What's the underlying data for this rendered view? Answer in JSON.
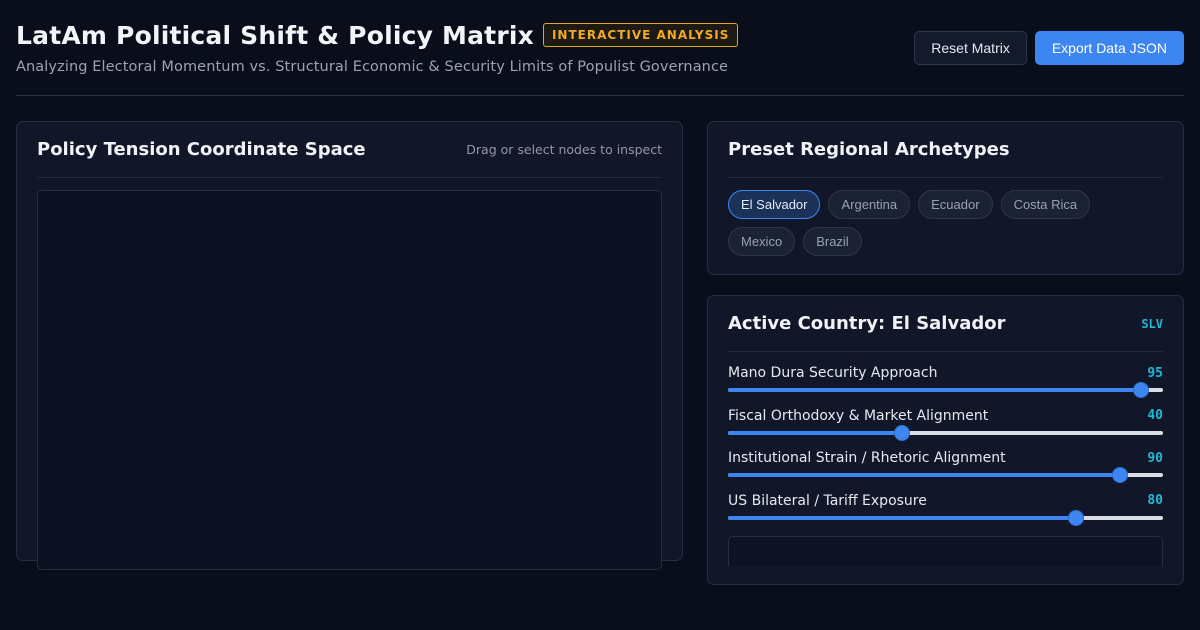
{
  "header": {
    "title": "LatAm Political Shift & Policy Matrix",
    "badge": "INTERACTIVE ANALYSIS",
    "subtitle": "Analyzing Electoral Momentum vs. Structural Economic & Security Limits of Populist Governance",
    "reset_label": "Reset Matrix",
    "export_label": "Export Data JSON"
  },
  "coordinate_panel": {
    "title": "Policy Tension Coordinate Space",
    "hint": "Drag or select nodes to inspect"
  },
  "presets": {
    "title": "Preset Regional Archetypes",
    "items": [
      "El Salvador",
      "Argentina",
      "Ecuador",
      "Costa Rica",
      "Mexico",
      "Brazil"
    ],
    "selected": "El Salvador"
  },
  "active_country": {
    "title": "Active Country: El Salvador",
    "code": "SLV",
    "sliders": [
      {
        "label": "Mano Dura Security Approach",
        "value": 95
      },
      {
        "label": "Fiscal Orthodoxy & Market Alignment",
        "value": 40
      },
      {
        "label": "Institutional Strain / Rhetoric Alignment",
        "value": 90
      },
      {
        "label": "US Bilateral / Tariff Exposure",
        "value": 80
      }
    ]
  },
  "colors": {
    "accent": "#3d85f0",
    "badge": "#f0aa24",
    "value": "#22b8d6",
    "background": "#090e1a"
  }
}
